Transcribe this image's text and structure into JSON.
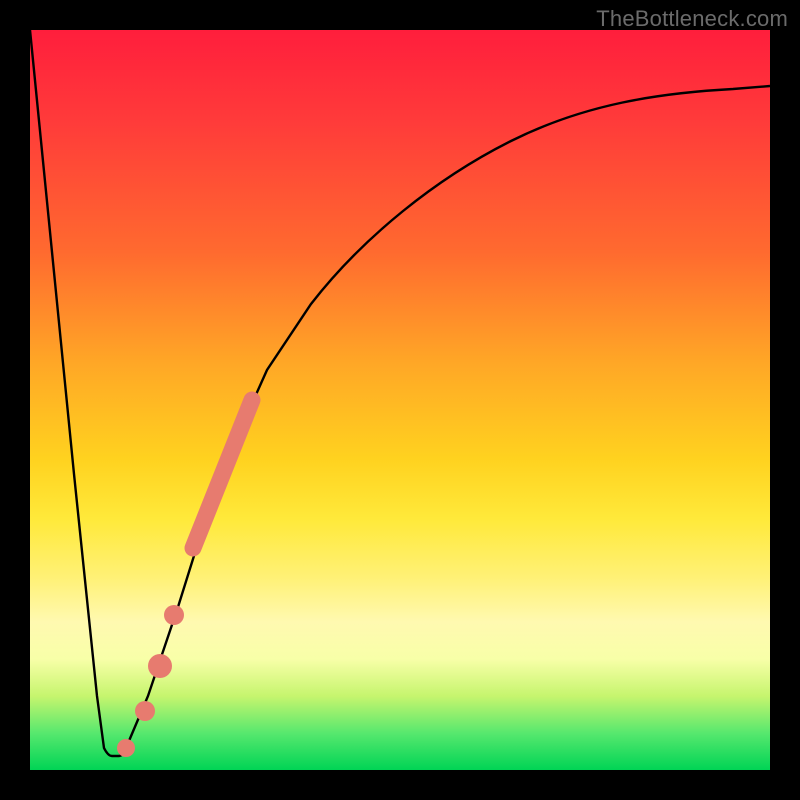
{
  "attribution": "TheBottleneck.com",
  "chart_data": {
    "type": "line",
    "title": "",
    "xlabel": "",
    "ylabel": "",
    "xlim": [
      0,
      100
    ],
    "ylim": [
      0,
      100
    ],
    "background_gradient": {
      "orientation": "vertical",
      "stops": [
        {
          "pos": 0,
          "color": "#ff1e3c"
        },
        {
          "pos": 30,
          "color": "#ff6a2f"
        },
        {
          "pos": 58,
          "color": "#ffd21f"
        },
        {
          "pos": 80,
          "color": "#fff9b0"
        },
        {
          "pos": 95,
          "color": "#57e86e"
        },
        {
          "pos": 100,
          "color": "#00d455"
        }
      ]
    },
    "series": [
      {
        "name": "bottleneck-curve",
        "color": "#000000",
        "x": [
          0,
          3,
          6,
          9,
          10,
          11,
          13,
          16,
          20,
          24,
          28,
          32,
          38,
          45,
          55,
          65,
          75,
          85,
          95,
          100
        ],
        "y": [
          100,
          70,
          40,
          10,
          3,
          2,
          3,
          10,
          22,
          35,
          45,
          54,
          63,
          72,
          80,
          85,
          88,
          90,
          91.5,
          92
        ]
      }
    ],
    "highlight_segments": [
      {
        "name": "highlight-bar",
        "color": "#e77b6f",
        "style": "thick-round",
        "x": [
          22,
          30
        ],
        "y": [
          30,
          50
        ]
      }
    ],
    "highlight_points": [
      {
        "name": "marker-1",
        "x": 19.5,
        "y": 21,
        "r": 1.4,
        "color": "#e77b6f"
      },
      {
        "name": "marker-2",
        "x": 17.5,
        "y": 14,
        "r": 1.6,
        "color": "#e77b6f"
      },
      {
        "name": "marker-3",
        "x": 15.5,
        "y": 8,
        "r": 1.4,
        "color": "#e77b6f"
      },
      {
        "name": "marker-4",
        "x": 13.0,
        "y": 3,
        "r": 1.2,
        "color": "#e77b6f"
      }
    ]
  }
}
